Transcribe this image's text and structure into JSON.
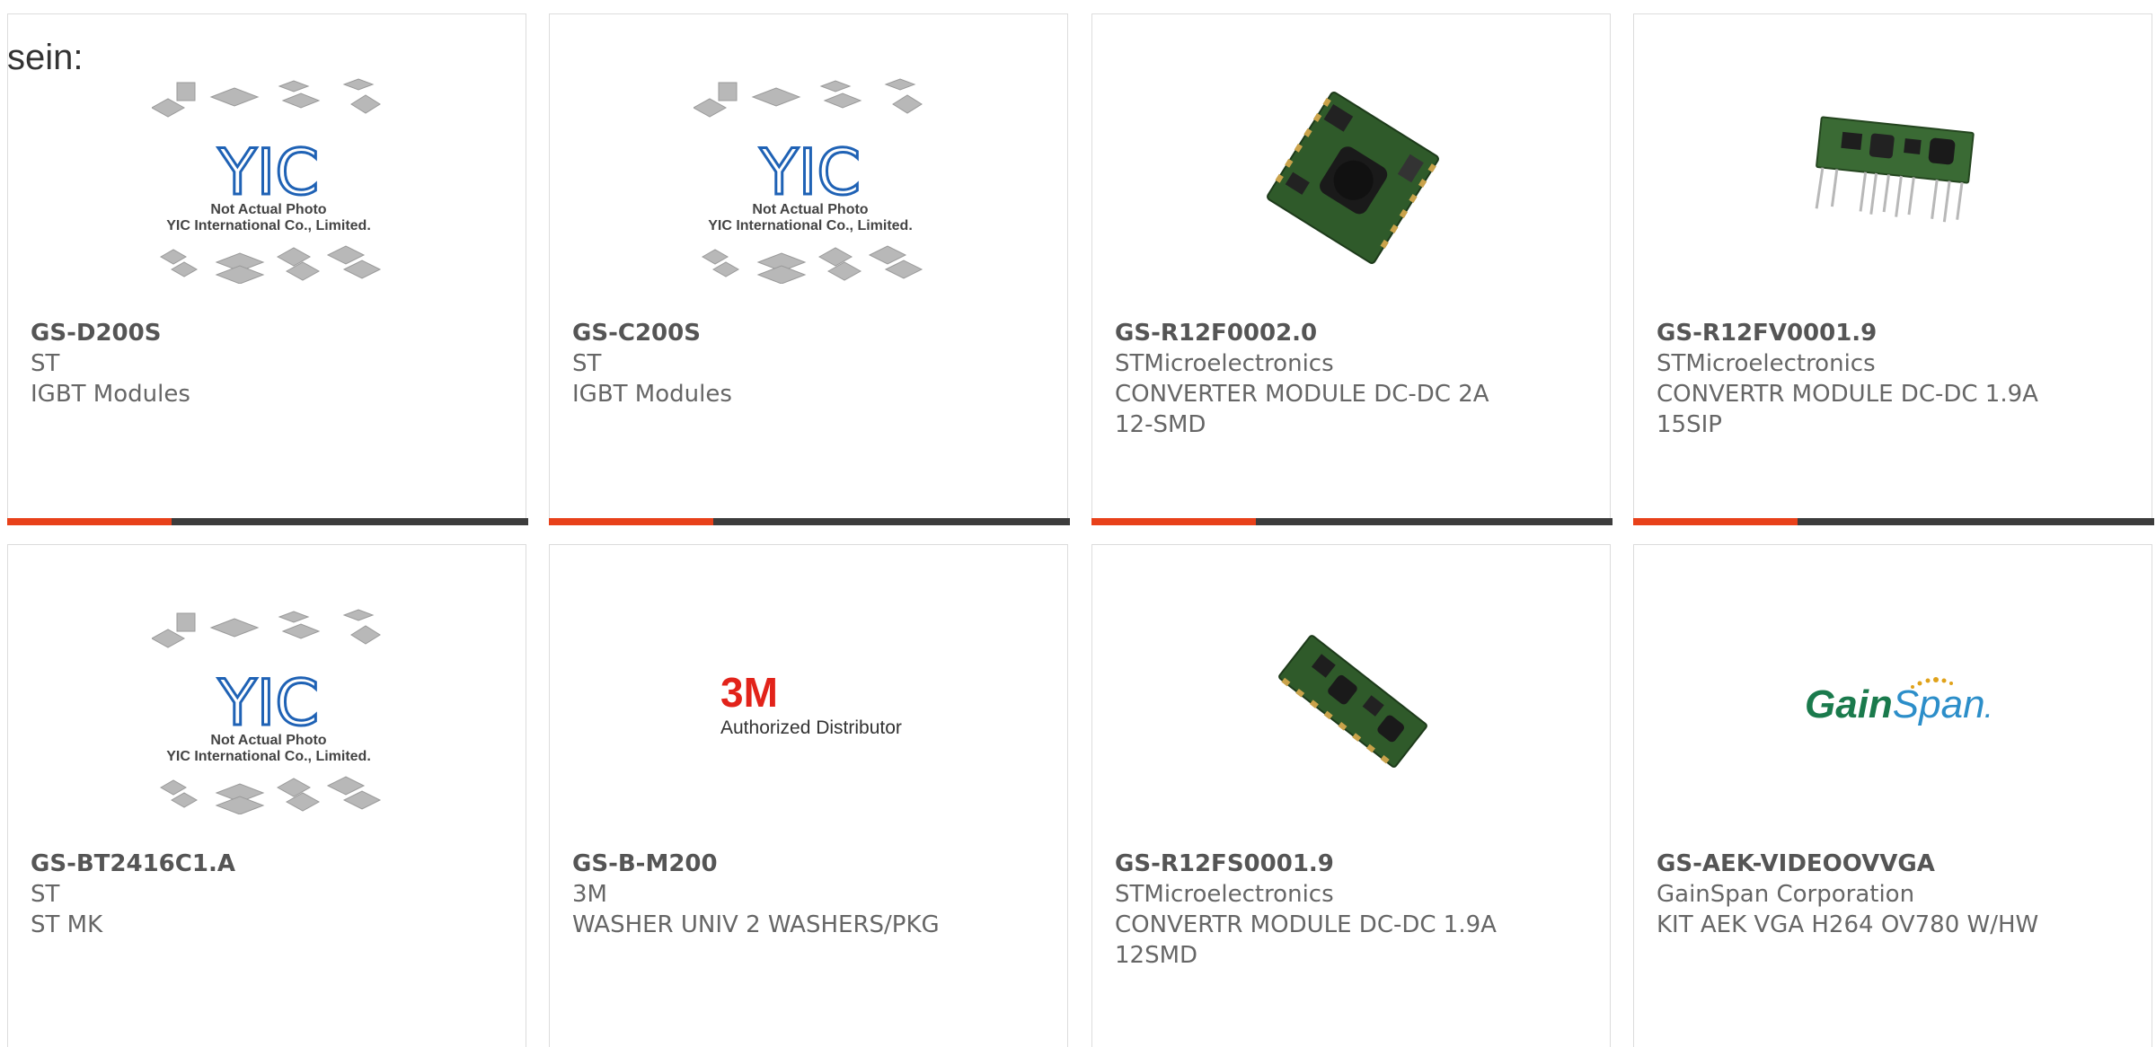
{
  "intro_text": "sein:",
  "placeholder": {
    "line1": "Not Actual Photo",
    "line2": "YIC International Co., Limited.",
    "logo": "YIC"
  },
  "brand_3m": {
    "logo": "3M",
    "tagline": "Authorized Distributor"
  },
  "brand_gainspan": {
    "logo_a": "Gain",
    "logo_b": "Span",
    "logo_dot": "."
  },
  "colors": {
    "accent": "#e8411a",
    "bar": "#3c3c3c",
    "border": "#dcdcdc",
    "yic_blue": "#1f62b5",
    "threem_red": "#e2231a",
    "gainspan_green": "#1a7a4c",
    "gainspan_blue": "#2c8ec9"
  },
  "products": [
    {
      "part": "GS-D200S",
      "maker": "ST",
      "desc": [
        "IGBT Modules"
      ],
      "image": "yic-placeholder"
    },
    {
      "part": "GS-C200S",
      "maker": "ST",
      "desc": [
        "IGBT Modules"
      ],
      "image": "yic-placeholder"
    },
    {
      "part": "GS-R12F0002.0",
      "maker": "STMicroelectronics",
      "desc": [
        "CONVERTER MODULE DC-DC 2A",
        "12-SMD"
      ],
      "image": "pcb-module-square"
    },
    {
      "part": "GS-R12FV0001.9",
      "maker": "STMicroelectronics",
      "desc": [
        "CONVERTR MODULE DC-DC 1.9A",
        "15SIP"
      ],
      "image": "pcb-module-sip"
    },
    {
      "part": "GS-BT2416C1.A",
      "maker": "ST",
      "desc": [
        "ST MK"
      ],
      "image": "yic-placeholder"
    },
    {
      "part": "GS-B-M200",
      "maker": "3M",
      "desc": [
        "WASHER UNIV 2 WASHERS/PKG"
      ],
      "image": "3m-logo"
    },
    {
      "part": "GS-R12FS0001.9",
      "maker": "STMicroelectronics",
      "desc": [
        "CONVERTR MODULE DC-DC 1.9A",
        "12SMD"
      ],
      "image": "pcb-module-long"
    },
    {
      "part": "GS-AEK-VIDEOOVVGA",
      "maker": "GainSpan Corporation",
      "desc": [
        "KIT AEK VGA H264 OV780 W/HW"
      ],
      "image": "gainspan-logo"
    }
  ]
}
